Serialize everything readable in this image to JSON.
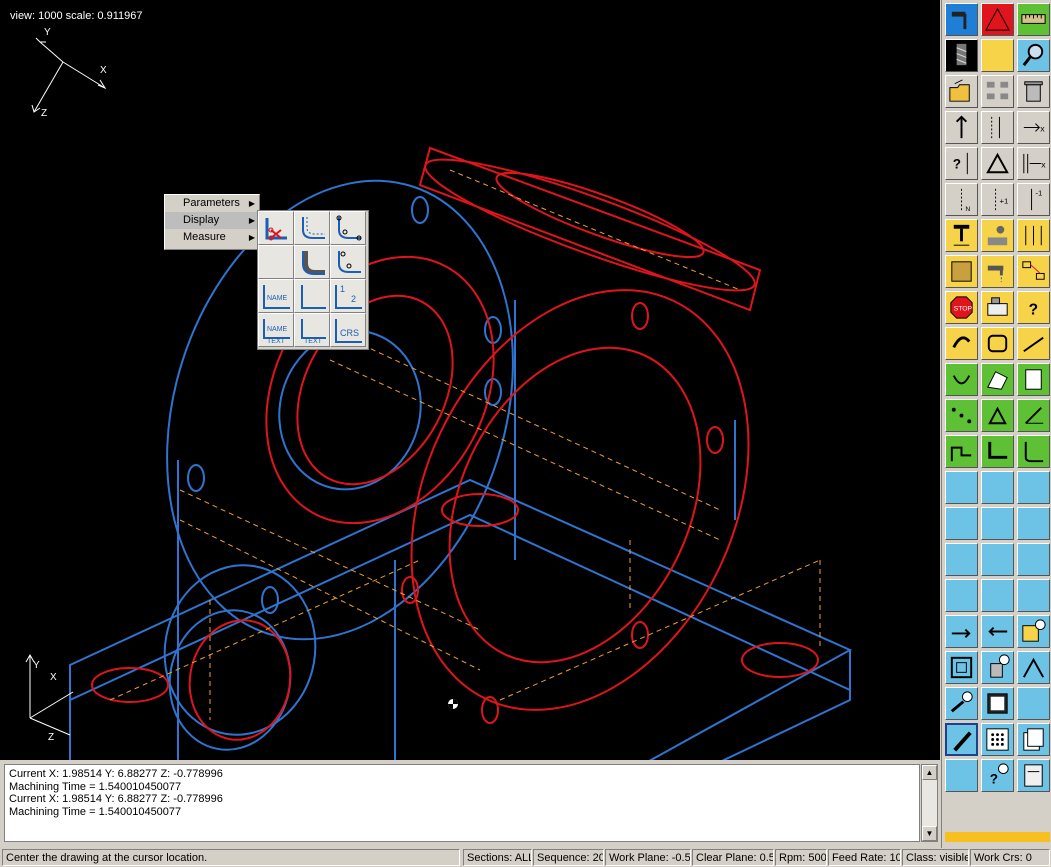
{
  "viewport": {
    "view_info": "view: 1000 scale: 0.911967",
    "axis_top": {
      "y": "Y",
      "x": "X",
      "z": "Z"
    },
    "axis_bottom": {
      "y": "Y",
      "x": "X",
      "z": "Z"
    },
    "colors": {
      "background": "#000000",
      "blue": "#2f74d0",
      "red": "#e0141c",
      "orange": "#f0a030",
      "white": "#ffffff"
    }
  },
  "context_menu": {
    "items": [
      {
        "label": "Parameters",
        "has_submenu": true
      },
      {
        "label": "Display",
        "has_submenu": true,
        "active": true
      },
      {
        "label": "Measure",
        "has_submenu": true
      }
    ],
    "submenu_icons": [
      "path-scissors-icon",
      "toolpath-offset-icon",
      "toolpath-points-icon",
      "blank-slot",
      "filled-profile-icon",
      "profile-points-icon",
      "name-label-icon",
      "axis-corner-icon",
      "sequence-numbers-icon",
      "name-text-label-icon",
      "text-label-icon",
      "crs-label-icon"
    ],
    "submenu_text": {
      "name": "NAME",
      "text": "TEXT",
      "n1": "1",
      "n2": "2",
      "crs": "CRS"
    }
  },
  "toolbar": {
    "buttons": [
      {
        "icon": "hammer-icon",
        "color": "#1f7fd6"
      },
      {
        "icon": "red-triangle-icon",
        "color": "#e0141c"
      },
      {
        "icon": "ruler-icon",
        "color": "#5ec034"
      },
      {
        "icon": "milling-tool-icon",
        "color": "#000000"
      },
      {
        "icon": "yellow-square-icon",
        "color": "#f7d34a"
      },
      {
        "icon": "magnifier-icon",
        "color": "#6cc3e6"
      },
      {
        "icon": "open-folder-icon"
      },
      {
        "icon": "sequence-shapes-icon"
      },
      {
        "icon": "trash-icon"
      },
      {
        "icon": "arrow-up-icon"
      },
      {
        "icon": "insert-n-icon"
      },
      {
        "icon": "move-right-x-icon"
      },
      {
        "icon": "question-arrow-icon"
      },
      {
        "icon": "delta-icon"
      },
      {
        "icon": "move-bracket-icon"
      },
      {
        "icon": "n-down-icon"
      },
      {
        "icon": "plus-one-icon"
      },
      {
        "icon": "minus-one-icon"
      },
      {
        "icon": "drill-icon"
      },
      {
        "icon": "pocket-tool-icon"
      },
      {
        "icon": "feed-tool-icon"
      },
      {
        "icon": "fill-pattern-icon"
      },
      {
        "icon": "coolant-faucet-icon"
      },
      {
        "icon": "process-icon"
      },
      {
        "icon": "stop-sign-icon"
      },
      {
        "icon": "machine-icon"
      },
      {
        "icon": "help-question-icon"
      },
      {
        "icon": "rotate-hands-icon"
      },
      {
        "icon": "contour-icon"
      },
      {
        "icon": "ramp-icon"
      },
      {
        "icon": "green-bowl-icon"
      },
      {
        "icon": "green-surface-icon"
      },
      {
        "icon": "green-hatch-icon"
      },
      {
        "icon": "green-points-icon"
      },
      {
        "icon": "green-delta-icon"
      },
      {
        "icon": "green-axis-icon"
      },
      {
        "icon": "green-step-icon"
      },
      {
        "icon": "green-profile-icon"
      },
      {
        "icon": "green-corner-icon"
      },
      {
        "icon": "empty-slot-icon"
      },
      {
        "icon": "empty-slot-icon"
      },
      {
        "icon": "empty-slot-icon"
      },
      {
        "icon": "empty-slot-icon"
      },
      {
        "icon": "empty-slot-icon"
      },
      {
        "icon": "empty-slot-icon"
      },
      {
        "icon": "empty-slot-icon"
      },
      {
        "icon": "empty-slot-icon"
      },
      {
        "icon": "empty-slot-icon"
      },
      {
        "icon": "empty-slot-icon"
      },
      {
        "icon": "empty-slot-icon"
      },
      {
        "icon": "empty-slot-icon"
      },
      {
        "icon": "insert-arrow-icon"
      },
      {
        "icon": "back-arrow-icon"
      },
      {
        "icon": "clock-pocket-icon"
      },
      {
        "icon": "nested-box-icon"
      },
      {
        "icon": "delete-timer-icon"
      },
      {
        "icon": "sweep-icon"
      },
      {
        "icon": "hand-timer-icon"
      },
      {
        "icon": "window-icon"
      },
      {
        "icon": "empty-slot-icon"
      },
      {
        "icon": "pen-icon"
      },
      {
        "icon": "dot-grid-icon"
      },
      {
        "icon": "pages-icon"
      },
      {
        "icon": "empty-slot-icon"
      },
      {
        "icon": "help-timer-icon"
      },
      {
        "icon": "guide-book-icon"
      }
    ]
  },
  "log": {
    "lines": [
      "Current X: 1.98514  Y: 6.88277  Z: -0.778996",
      "Machining Time = 1.540010450077",
      "Current X: 1.98514  Y: 6.88277  Z: -0.778996",
      "Machining Time = 1.540010450077"
    ]
  },
  "status": {
    "message": "Center the drawing at the cursor location.",
    "sections": "Sections: ALL",
    "sequence": "Sequence: 20",
    "work_plane": "Work Plane: -0.5",
    "clear_plane": "Clear Plane: 0.5",
    "rpm": "Rpm: 500",
    "feed_rate": "Feed Rate: 10",
    "class": "Class: visible",
    "work_crs": "Work Crs: 0"
  }
}
